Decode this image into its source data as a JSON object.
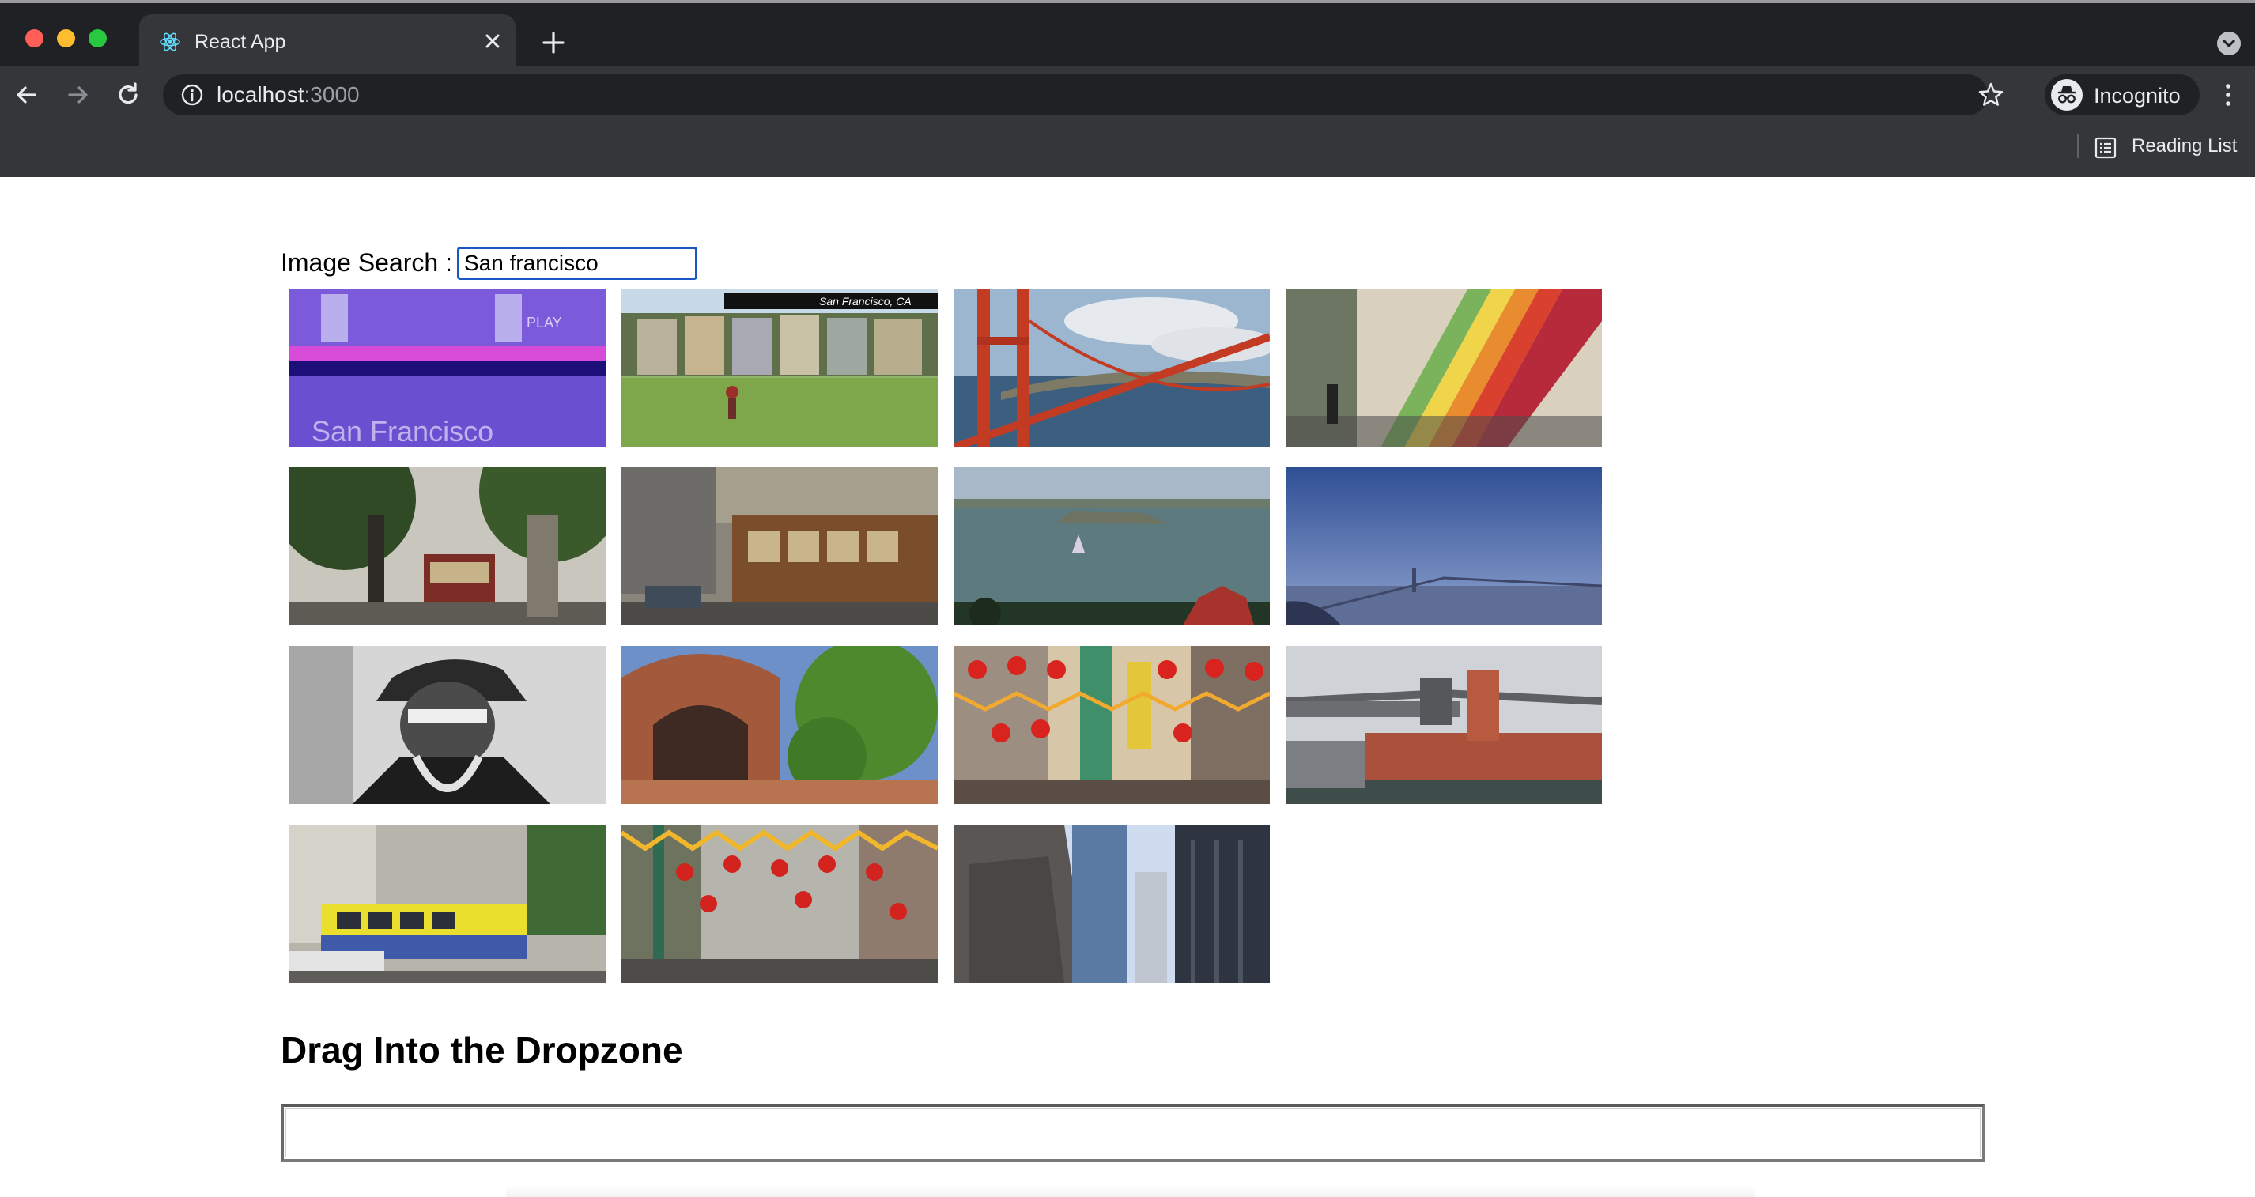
{
  "browser": {
    "tab_title": "React App",
    "url_host": "localhost",
    "url_port": ":3000",
    "profile_label": "Incognito",
    "bookmark_label": "Reading List",
    "icons": [
      "react-favicon-icon",
      "close-icon",
      "plus-icon",
      "chevron-down-icon",
      "back-arrow-icon",
      "forward-arrow-icon",
      "reload-icon",
      "info-icon",
      "star-icon",
      "incognito-icon",
      "kebab-menu-icon",
      "reading-list-icon"
    ]
  },
  "search": {
    "label": "Image Search :",
    "value": "San francisco"
  },
  "results": [
    {
      "name": "result-thumbnail-1",
      "overlay_text": [
        "PLAY",
        "San Francisco"
      ]
    },
    {
      "name": "result-thumbnail-2",
      "overlay_text": [
        "San Francisco, CA"
      ]
    },
    {
      "name": "result-thumbnail-3"
    },
    {
      "name": "result-thumbnail-4"
    },
    {
      "name": "result-thumbnail-5"
    },
    {
      "name": "result-thumbnail-6"
    },
    {
      "name": "result-thumbnail-7"
    },
    {
      "name": "result-thumbnail-8"
    },
    {
      "name": "result-thumbnail-9"
    },
    {
      "name": "result-thumbnail-10"
    },
    {
      "name": "result-thumbnail-11"
    },
    {
      "name": "result-thumbnail-12"
    },
    {
      "name": "result-thumbnail-13"
    },
    {
      "name": "result-thumbnail-14"
    },
    {
      "name": "result-thumbnail-15"
    }
  ],
  "dropzone": {
    "heading": "Drag Into the Dropzone"
  }
}
